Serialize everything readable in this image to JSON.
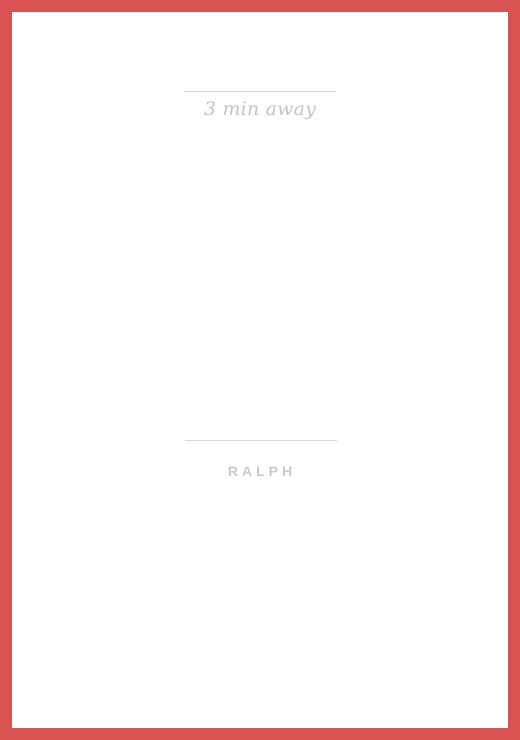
{
  "theme": {
    "frame_color": "#d95352",
    "card_color": "#ffffff",
    "text_color": "#c4c4c4",
    "divider_color": "#d9d9d9"
  },
  "eta": {
    "text": "3 min away"
  },
  "driver": {
    "name": "RALPH"
  }
}
